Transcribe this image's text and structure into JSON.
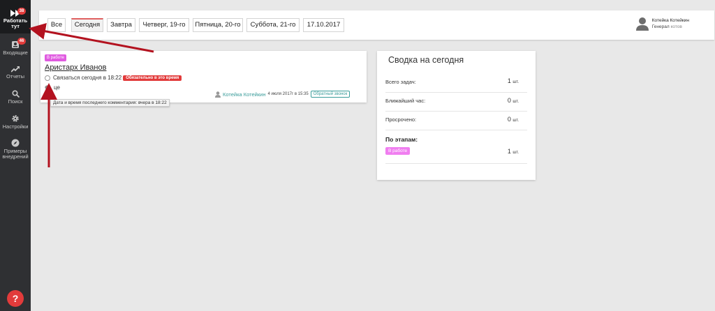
{
  "sidebar": {
    "items": [
      {
        "label_line1": "Работать",
        "label_line2": "тут",
        "badge": "38",
        "icon": "fast-forward-icon"
      },
      {
        "label": "Входящие",
        "badge": "46",
        "icon": "inbox-icon"
      },
      {
        "label": "Отчеты",
        "icon": "trending-up-icon"
      },
      {
        "label": "Поиск",
        "icon": "search-icon"
      },
      {
        "label": "Настройки",
        "icon": "gear-icon"
      },
      {
        "label_line1": "Примеры",
        "label_line2": "внедрений",
        "icon": "compass-icon"
      }
    ],
    "help_label": "?"
  },
  "tabs": [
    "Все",
    "Сегодня",
    "Завтра",
    "Четверг, 19-го",
    "Пятница, 20-го",
    "Суббота, 21-го",
    "17.10.2017"
  ],
  "user": {
    "name": "Котейка Котейкин",
    "role": "Генерал",
    "role_suffix": "котов"
  },
  "task": {
    "status": "В работе",
    "title": "Аристарх Иванов",
    "action": "Связаться сегодня в 18:22",
    "urgent_label": "Обязательно в это время",
    "comment": "це",
    "tooltip": "Дата и время последнего комментария: вчера в 18:22",
    "assignee": "Котейка Котейкин",
    "date": "4 июля 2017г в 15:35",
    "type": "Обратный звонок"
  },
  "summary": {
    "title": "Сводка на сегодня",
    "rows": [
      {
        "label": "Всего задач:",
        "value": "1",
        "unit": "шт."
      },
      {
        "label": "Ближайший час:",
        "value": "0",
        "unit": "шт."
      },
      {
        "label": "Просрочено:",
        "value": "0",
        "unit": "шт."
      }
    ],
    "stages_title": "По этапам:",
    "stage": {
      "label": "В работе",
      "value": "1",
      "unit": "шт."
    }
  },
  "colors": {
    "sidebar": "#2f3033",
    "accent_red": "#e23b3b",
    "stage_pink": "#f07ef0",
    "link_teal": "#3a9c9a",
    "arrow": "#b3121f"
  }
}
